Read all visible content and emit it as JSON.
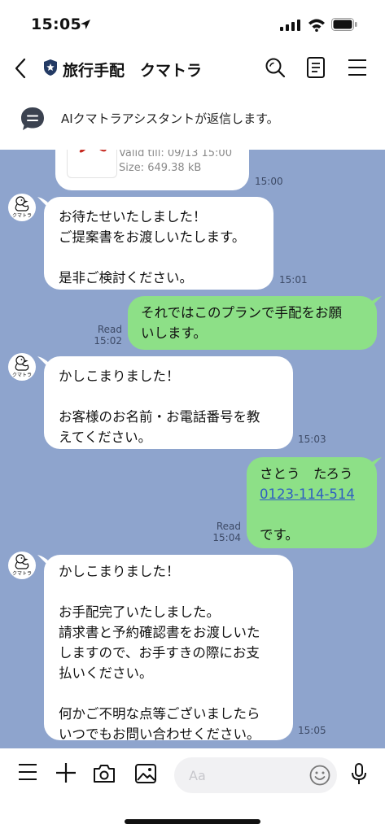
{
  "status_bar": {
    "time": "15:05"
  },
  "header": {
    "title": "旅行手配　クマトラ"
  },
  "banner": {
    "text": "AIクマトラアシスタントが返信します。"
  },
  "avatar": {
    "label": "クマトラ"
  },
  "messages": {
    "file_card": {
      "valid": "Valid till: 09/13 15:00",
      "size": "Size: 649.38 kB",
      "time": "15:00"
    },
    "m1": {
      "text": "お待たせいたしました！\nご提案書をお渡しいたします。\n\n是非ご検討ください。",
      "time": "15:01"
    },
    "m2": {
      "text": "それではこのプランで手配をお願\nいします。",
      "read": "Read",
      "time": "15:02"
    },
    "m3": {
      "text": "かしこまりました！\n\nお客様のお名前・お電話番号を教\nえてください。",
      "time": "15:03"
    },
    "m4": {
      "name": "さとう　たろう",
      "phone": "0123-114-514",
      "suffix": "です。",
      "read": "Read",
      "time": "15:04"
    },
    "m5": {
      "text": "かしこまりました！\n\nお手配完了いたしました。\n請求書と予約確認書をお渡しいた\nしますので、お手すきの際にお支\n払いください。\n\n何かご不明な点等ございましたら\nいつでもお問い合わせください。",
      "time": "15:05"
    }
  },
  "input": {
    "placeholder": "Aa"
  },
  "colors": {
    "chat_background": "#8ea4cd",
    "outgoing_bubble": "#8de087",
    "incoming_bubble": "#ffffff",
    "link": "#2f5ec2"
  },
  "icons": [
    "location-arrow-icon",
    "signal-icon",
    "wifi-icon",
    "battery-icon",
    "back-icon",
    "shield-icon",
    "search-icon",
    "notes-icon",
    "menu-icon",
    "chat-bubble-icon",
    "pdf-icon",
    "duck-avatar-icon",
    "plus-icon",
    "camera-icon",
    "image-icon",
    "emoji-icon",
    "mic-icon"
  ]
}
